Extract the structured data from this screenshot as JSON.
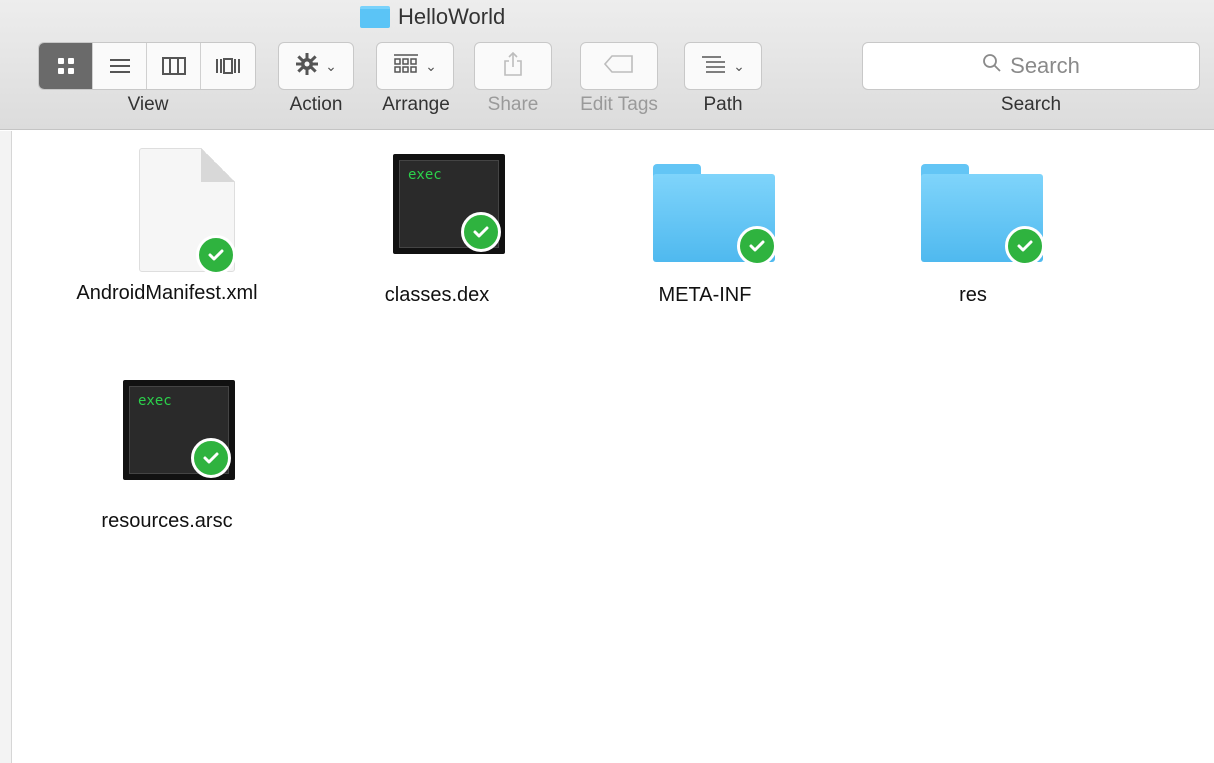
{
  "window": {
    "title": "HelloWorld"
  },
  "toolbar": {
    "view_label": "View",
    "action_label": "Action",
    "arrange_label": "Arrange",
    "share_label": "Share",
    "edit_tags_label": "Edit Tags",
    "path_label": "Path",
    "search_label": "Search",
    "search_placeholder": "Search",
    "view_modes": [
      "icon-view-icon",
      "list-view-icon",
      "column-view-icon",
      "cover-flow-icon"
    ],
    "active_view": "icon-view-icon"
  },
  "files": [
    {
      "name": "AndroidManifest.xml",
      "type": "document",
      "synced": true
    },
    {
      "name": "classes.dex",
      "type": "exec",
      "icon_text": "exec",
      "synced": true
    },
    {
      "name": "META-INF",
      "type": "folder",
      "synced": true
    },
    {
      "name": "res",
      "type": "folder",
      "synced": true
    },
    {
      "name": "resources.arsc",
      "type": "exec",
      "icon_text": "exec",
      "synced": true
    }
  ],
  "colors": {
    "folder": "#5bc4f6",
    "badge": "#2fb33f",
    "exec_text": "#2bd14b"
  }
}
